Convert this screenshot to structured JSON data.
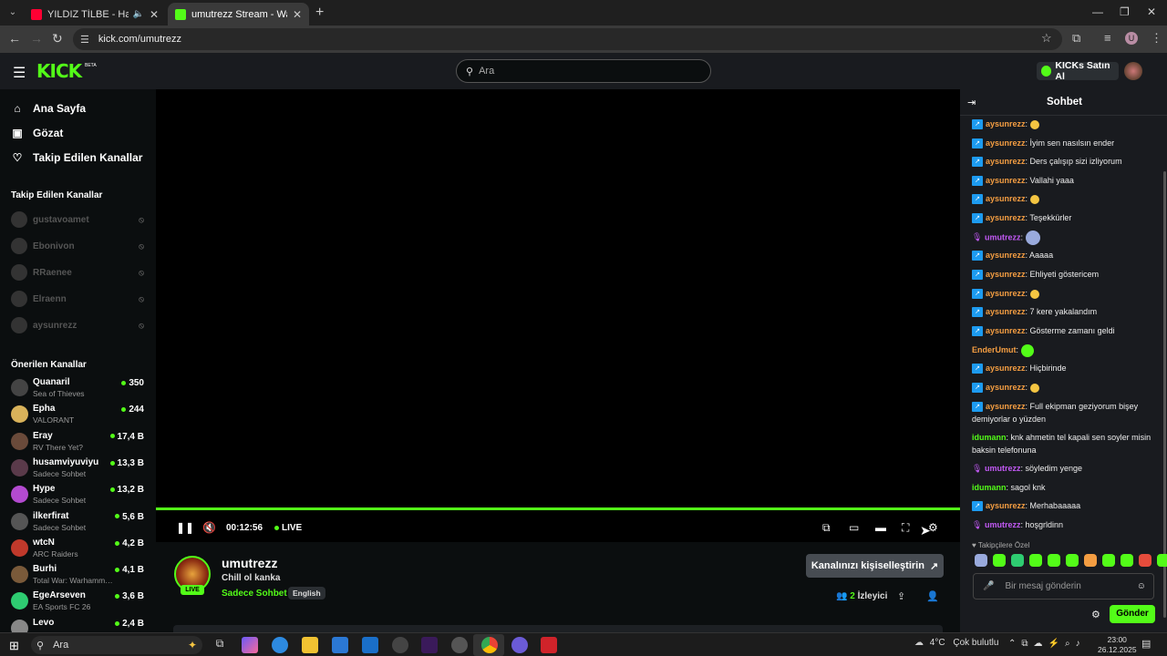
{
  "browser": {
    "tabs": [
      {
        "title": "YILDIZ TİLBE - Hasretim Ber",
        "fav": "#ff0033"
      },
      {
        "title": "umutrezz Stream - Watch Live o",
        "fav": "#53fc18"
      }
    ],
    "url": "kick.com/umutrezz",
    "profile_initial": "U"
  },
  "header": {
    "logo": "KICK",
    "beta": "BETA",
    "search_placeholder": "Ara",
    "kicks_button": "KICKs Satın Al"
  },
  "sidebar": {
    "nav": [
      {
        "label": "Ana Sayfa",
        "icon": "⌂"
      },
      {
        "label": "Gözat",
        "icon": "▣"
      },
      {
        "label": "Takip Edilen Kanallar",
        "icon": "♡"
      }
    ],
    "followed_title": "Takip Edilen Kanallar",
    "followed": [
      "gustavoamet",
      "Ebonivon",
      "RRaenee",
      "Elraenn",
      "aysunrezz"
    ],
    "recommended_title": "Önerilen Kanallar",
    "recommended": [
      {
        "name": "Quanaril",
        "game": "Sea of Thieves",
        "viewers": "350",
        "color": "#444"
      },
      {
        "name": "Epha",
        "game": "VALORANT",
        "viewers": "244",
        "color": "#d8b25a"
      },
      {
        "name": "Eray",
        "game": "RV There Yet?",
        "viewers": "17,4 B",
        "color": "#6a4a3a"
      },
      {
        "name": "husamviyuviyu",
        "game": "Sadece Sohbet",
        "viewers": "13,3 B",
        "color": "#5a3a4a"
      },
      {
        "name": "Hype",
        "game": "Sadece Sohbet",
        "viewers": "13,2 B",
        "color": "#b34ad0"
      },
      {
        "name": "ilkerfirat",
        "game": "Sadece Sohbet",
        "viewers": "5,6 B",
        "color": "#555"
      },
      {
        "name": "wtcN",
        "game": "ARC Raiders",
        "viewers": "4,2 B",
        "color": "#c0392b"
      },
      {
        "name": "Burhi",
        "game": "Total War: Warhamm…",
        "viewers": "4,1 B",
        "color": "#7a5a3a"
      },
      {
        "name": "EgeArseven",
        "game": "EA Sports FC 26",
        "viewers": "3,6 B",
        "color": "#2ecc71"
      },
      {
        "name": "Levo",
        "game": "",
        "viewers": "2,4 B",
        "color": "#888"
      }
    ]
  },
  "player": {
    "time": "00:12:56",
    "live": "LIVE"
  },
  "channel": {
    "name": "umutrezz",
    "title": "Chill ol kanka",
    "category": "Sadece Sohbet",
    "language": "English",
    "live_badge": "LIVE",
    "customize_button": "Kanalınızı kişiselleştirin",
    "viewers_count": "2",
    "viewers_label": "İzleyici"
  },
  "chat": {
    "title": "Sohbet",
    "messages": [
      {
        "user": "aysunrezz",
        "text": "",
        "emoji": "😀",
        "type": "ays"
      },
      {
        "user": "aysunrezz",
        "text": "İyim sen nasılsın ender",
        "type": "ays"
      },
      {
        "user": "aysunrezz",
        "text": "Ders çalışıp sizi izliyorum",
        "type": "ays"
      },
      {
        "user": "aysunrezz",
        "text": "Vallahi yaaa",
        "type": "ays"
      },
      {
        "user": "aysunrezz",
        "text": "",
        "type": "ays"
      },
      {
        "user": "aysunrezz",
        "text": "Teşekkürler",
        "type": "ays"
      },
      {
        "user": "umutrezz",
        "text": "",
        "type": "umu"
      },
      {
        "user": "aysunrezz",
        "text": "Aaaaa",
        "type": "ays"
      },
      {
        "user": "aysunrezz",
        "text": "Ehliyeti göstericem",
        "type": "ays"
      },
      {
        "user": "aysunrezz",
        "text": "",
        "type": "ays"
      },
      {
        "user": "aysunrezz",
        "text": "7 kere yakalandım",
        "type": "ays"
      },
      {
        "user": "aysunrezz",
        "text": "Gösterme zamanı geldi",
        "type": "ays"
      },
      {
        "user": "EnderUmut",
        "text": "",
        "type": "end"
      },
      {
        "user": "aysunrezz",
        "text": "Hiçbirinde",
        "type": "ays"
      },
      {
        "user": "aysunrezz",
        "text": "",
        "type": "ays"
      },
      {
        "user": "aysunrezz",
        "text": "Full ekipman geziyorum bişey demiyorlar o yüzden",
        "type": "ays"
      },
      {
        "user": "idumann",
        "text": "knk ahmetin tel kapali sen soyler misin baksin telefonuna",
        "type": "idu"
      },
      {
        "user": "umutrezz",
        "text": "söyledim yenge",
        "type": "umu"
      },
      {
        "user": "idumann",
        "text": "sagol knk",
        "type": "idu"
      },
      {
        "user": "aysunrezz",
        "text": "Merhabaaaaa",
        "type": "ays"
      },
      {
        "user": "umutrezz",
        "text": "hoşgrldinn",
        "type": "umu"
      }
    ],
    "followers_only": "Takipçilere Özel",
    "input_placeholder": "Bir mesaj gönderin",
    "send_label": "Gönder"
  },
  "taskbar": {
    "search": "Ara",
    "weather_temp": "4°C",
    "weather_desc": "Çok bulutlu",
    "time": "23:00",
    "date": "26.12.2025"
  }
}
